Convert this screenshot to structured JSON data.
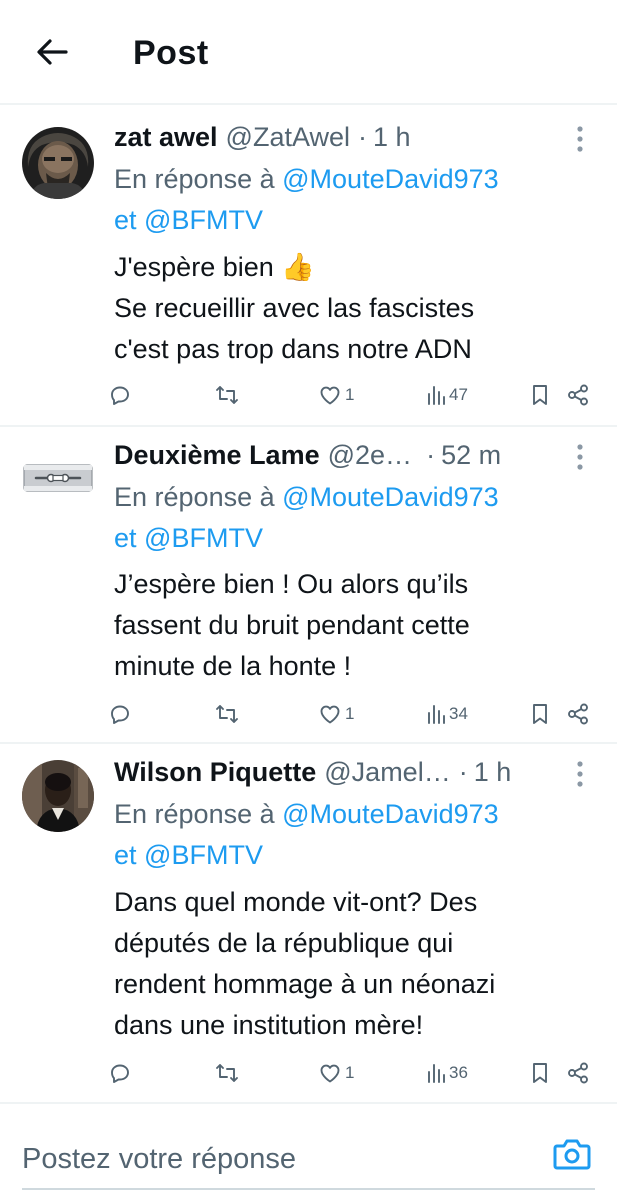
{
  "header": {
    "title": "Post"
  },
  "tweets": [
    {
      "name": "zat awel",
      "handle": "@ZatAwel",
      "time": "1 h",
      "reply_prefix": "En réponse à",
      "mention1": "@MouteDavid973",
      "reply_joiner": "et",
      "mention2": "@BFMTV",
      "lines": [
        "J'espère bien 👍",
        "Se recueillir avec las fascistes",
        "c'est pas trop dans notre ADN"
      ],
      "likes": "1",
      "views": "47"
    },
    {
      "name": "Deuxième Lame",
      "handle": "@2e…",
      "time": "52 m",
      "reply_prefix": "En réponse à",
      "mention1": "@MouteDavid973",
      "reply_joiner": "et",
      "mention2": "@BFMTV",
      "lines": [
        "J’espère bien ! Ou alors qu’ils",
        "fassent du bruit pendant cette",
        "minute de la honte !"
      ],
      "likes": "1",
      "views": "34"
    },
    {
      "name": "Wilson Piquette",
      "handle": "@Jamel…",
      "time": "1 h",
      "reply_prefix": "En réponse à",
      "mention1": "@MouteDavid973",
      "reply_joiner": "et",
      "mention2": "@BFMTV",
      "lines": [
        "Dans quel monde vit-ont? Des",
        "députés de la république qui",
        "rendent hommage à un néonazi",
        "dans une institution mère!"
      ],
      "likes": "1",
      "views": "36"
    }
  ],
  "reply_bar": {
    "placeholder": "Postez votre réponse"
  },
  "colors": {
    "accent": "#1d9bf0",
    "text": "#0f1419",
    "secondary": "#536471",
    "divider": "#eff3f4"
  },
  "icons": [
    "back-arrow-icon",
    "more-vertical-icon",
    "reply-icon",
    "repost-icon",
    "like-icon",
    "views-icon",
    "bookmark-icon",
    "share-icon",
    "camera-icon"
  ]
}
